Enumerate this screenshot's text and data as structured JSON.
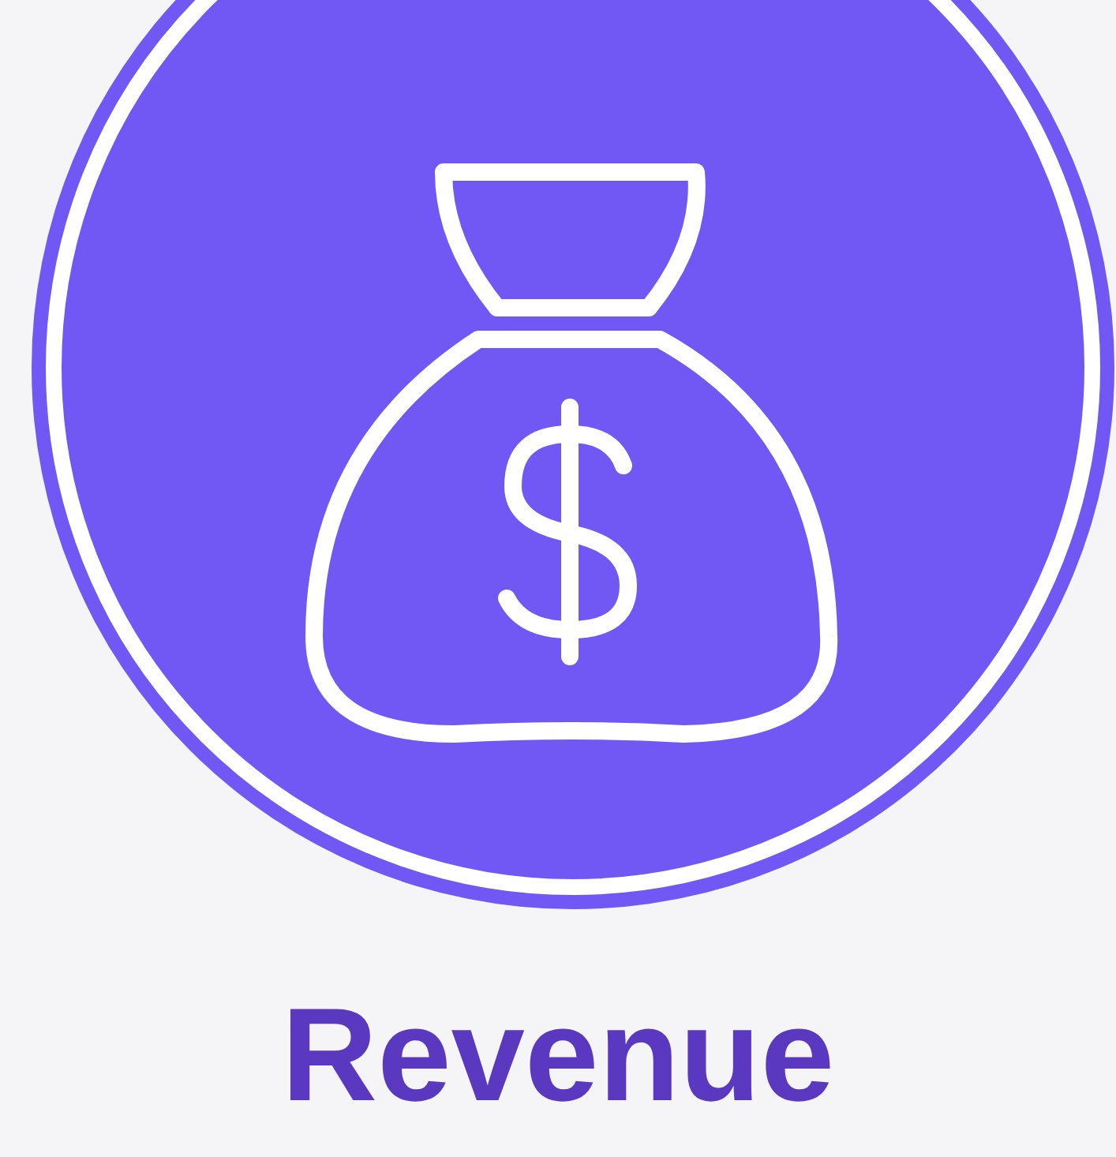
{
  "heading": "Revenue"
}
